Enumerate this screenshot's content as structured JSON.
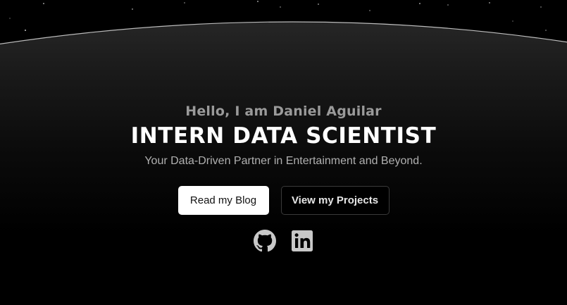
{
  "hero": {
    "greeting": "Hello, I am Daniel Aguilar",
    "title": "INTERN DATA SCIENTIST",
    "tagline": "Your Data-Driven Partner in Entertainment and Beyond."
  },
  "buttons": {
    "blog_label": "Read my Blog",
    "projects_label": "View my Projects"
  },
  "socials": [
    {
      "icon": "github-icon"
    },
    {
      "icon": "linkedin-icon"
    }
  ],
  "colors": {
    "background": "#000000",
    "title": "#ffffff",
    "greeting": "#9a9a9a",
    "tagline": "#b0b0b0",
    "icon": "#c8c8c8"
  }
}
